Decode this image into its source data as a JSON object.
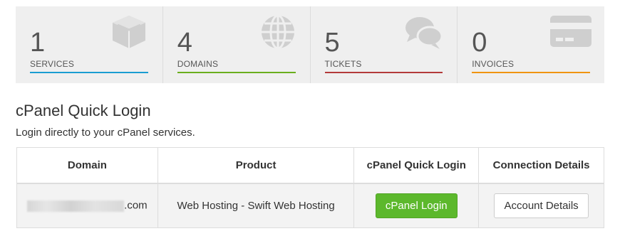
{
  "stats": [
    {
      "count": "1",
      "label": "SERVICES",
      "color": "#1b9dd1",
      "icon": "cube-icon"
    },
    {
      "count": "4",
      "label": "DOMAINS",
      "color": "#6aae1d",
      "icon": "globe-icon"
    },
    {
      "count": "5",
      "label": "TICKETS",
      "color": "#b33a3a",
      "icon": "chat-bubbles-icon"
    },
    {
      "count": "0",
      "label": "INVOICES",
      "color": "#f09410",
      "icon": "credit-card-icon"
    }
  ],
  "section": {
    "title": "cPanel Quick Login",
    "subtitle": "Login directly to your cPanel services."
  },
  "table": {
    "headers": [
      "Domain",
      "Product",
      "cPanel Quick Login",
      "Connection Details"
    ],
    "rows": [
      {
        "domain_suffix": ".com",
        "product": "Web Hosting - Swift Web Hosting",
        "login_label": "cPanel Login",
        "details_label": "Account Details"
      }
    ]
  },
  "colors": {
    "login_button": "#5cb82c",
    "tile_background": "#efefef"
  }
}
